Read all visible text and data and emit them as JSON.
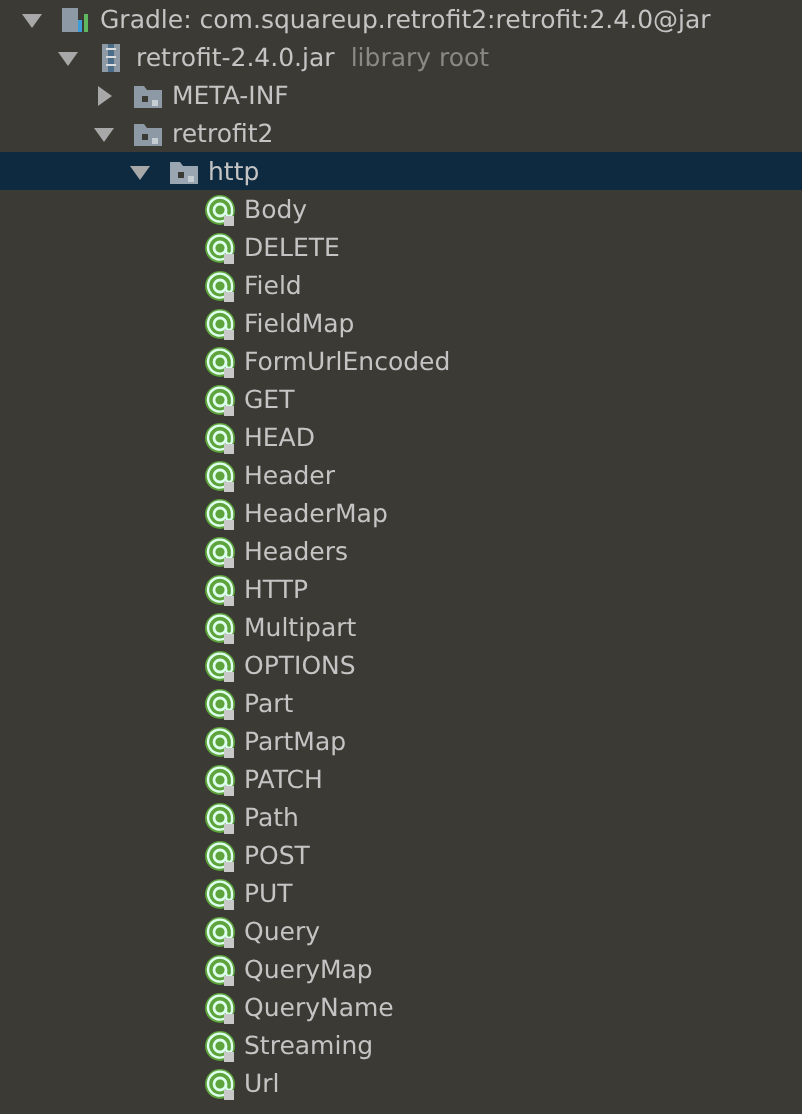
{
  "tree": [
    {
      "kind": "gradle",
      "label": "Gradle: com.squareup.retrofit2:retrofit:2.4.0@jar",
      "expanded": true,
      "selected": false,
      "children": [
        {
          "kind": "jar",
          "label": "retrofit-2.4.0.jar",
          "suffix": "library root",
          "expanded": true,
          "selected": false,
          "children": [
            {
              "kind": "folder",
              "label": "META-INF",
              "expanded": false,
              "selected": false
            },
            {
              "kind": "folder",
              "label": "retrofit2",
              "expanded": true,
              "selected": false,
              "children": [
                {
                  "kind": "package",
                  "label": "http",
                  "expanded": true,
                  "selected": true,
                  "children": [
                    {
                      "kind": "annotation",
                      "label": "Body",
                      "selected": false
                    },
                    {
                      "kind": "annotation",
                      "label": "DELETE",
                      "selected": false
                    },
                    {
                      "kind": "annotation",
                      "label": "Field",
                      "selected": false
                    },
                    {
                      "kind": "annotation",
                      "label": "FieldMap",
                      "selected": false
                    },
                    {
                      "kind": "annotation",
                      "label": "FormUrlEncoded",
                      "selected": false
                    },
                    {
                      "kind": "annotation",
                      "label": "GET",
                      "selected": false
                    },
                    {
                      "kind": "annotation",
                      "label": "HEAD",
                      "selected": false
                    },
                    {
                      "kind": "annotation",
                      "label": "Header",
                      "selected": false
                    },
                    {
                      "kind": "annotation",
                      "label": "HeaderMap",
                      "selected": false
                    },
                    {
                      "kind": "annotation",
                      "label": "Headers",
                      "selected": false
                    },
                    {
                      "kind": "annotation",
                      "label": "HTTP",
                      "selected": false
                    },
                    {
                      "kind": "annotation",
                      "label": "Multipart",
                      "selected": false
                    },
                    {
                      "kind": "annotation",
                      "label": "OPTIONS",
                      "selected": false
                    },
                    {
                      "kind": "annotation",
                      "label": "Part",
                      "selected": false
                    },
                    {
                      "kind": "annotation",
                      "label": "PartMap",
                      "selected": false
                    },
                    {
                      "kind": "annotation",
                      "label": "PATCH",
                      "selected": false
                    },
                    {
                      "kind": "annotation",
                      "label": "Path",
                      "selected": false
                    },
                    {
                      "kind": "annotation",
                      "label": "POST",
                      "selected": false
                    },
                    {
                      "kind": "annotation",
                      "label": "PUT",
                      "selected": false
                    },
                    {
                      "kind": "annotation",
                      "label": "Query",
                      "selected": false
                    },
                    {
                      "kind": "annotation",
                      "label": "QueryMap",
                      "selected": false
                    },
                    {
                      "kind": "annotation",
                      "label": "QueryName",
                      "selected": false
                    },
                    {
                      "kind": "annotation",
                      "label": "Streaming",
                      "selected": false
                    },
                    {
                      "kind": "annotation",
                      "label": "Url",
                      "selected": false
                    }
                  ]
                }
              ]
            }
          ]
        }
      ]
    }
  ]
}
